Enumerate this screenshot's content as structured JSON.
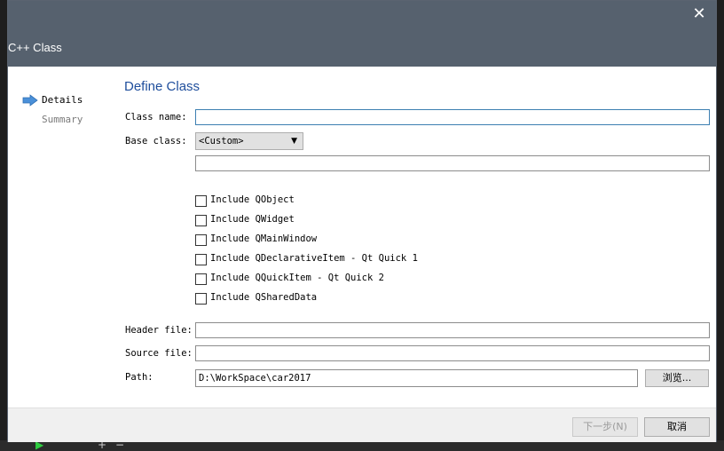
{
  "dialog": {
    "title": "C++ Class",
    "close_glyph": "✕"
  },
  "sidebar": {
    "items": [
      {
        "label": "Details",
        "active": true
      },
      {
        "label": "Summary",
        "active": false
      }
    ]
  },
  "page": {
    "title": "Define Class",
    "class_name_label": "Class name:",
    "class_name_value": "",
    "base_class_label": "Base class:",
    "base_class_selected": "<Custom>",
    "base_class_custom_value": "",
    "includes": [
      {
        "label": "Include QObject",
        "checked": false
      },
      {
        "label": "Include QWidget",
        "checked": false
      },
      {
        "label": "Include QMainWindow",
        "checked": false
      },
      {
        "label": "Include QDeclarativeItem - Qt Quick 1",
        "checked": false
      },
      {
        "label": "Include QQuickItem - Qt Quick 2",
        "checked": false
      },
      {
        "label": "Include QSharedData",
        "checked": false
      }
    ],
    "header_file_label": "Header file:",
    "header_file_value": "",
    "source_file_label": "Source file:",
    "source_file_value": "",
    "path_label": "Path:",
    "path_value": "D:\\WorkSpace\\car2017",
    "browse_label": "浏览..."
  },
  "footer": {
    "next_label": "下一步(N)",
    "cancel_label": "取消"
  },
  "colors": {
    "titlebar": "#56616e",
    "page_title": "#1f4e9c",
    "arrow": "#4a90d9",
    "focus_border": "#3c7fb1"
  },
  "icons": {
    "active_step": "arrow-right-icon",
    "dropdown": "chevron-down-icon",
    "close": "close-icon"
  }
}
